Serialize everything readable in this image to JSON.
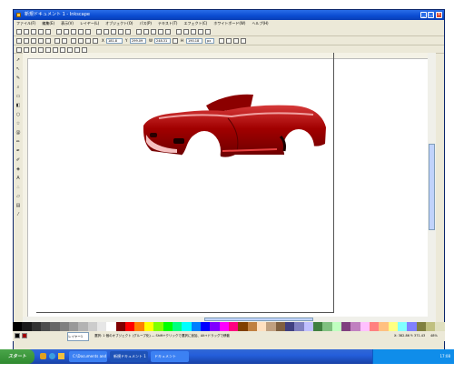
{
  "window": {
    "title": "新規ドキュメント 1 - Inkscape"
  },
  "menu": [
    "ファイル(F)",
    "編集(E)",
    "表示(V)",
    "レイヤー(L)",
    "オブジェクト(O)",
    "パス(P)",
    "テキスト(T)",
    "エフェクト(C)",
    "ホワイトボード(W)",
    "ヘルプ(H)"
  ],
  "toolbar2": {
    "x_label": "X",
    "x_value": "181.8",
    "y_label": "Y",
    "y_value": "299.09",
    "w_label": "W",
    "w_value": "248.31",
    "h_label": "H",
    "h_value": "190.18",
    "unit": "px"
  },
  "status": {
    "layer": "レイヤー1",
    "message": "選択: 1 個のオブジェクト (グループ化) — Shift+クリックで選択に追加、Alt+ドラッグで移動",
    "coords": "X: 382.86  Y: 371.43",
    "zoom": "48%"
  },
  "taskbar": {
    "start": "スタート",
    "tasks": [
      "C:\\Documents and Settings",
      "新規ドキュメント 1 - Inkscape",
      "ドキュメント"
    ],
    "clock": "17:08"
  },
  "colors": {
    "car_body": "#a10000",
    "car_highlight": "#e84040",
    "title_bar": "#0a4bd1"
  },
  "palette": [
    "#000000",
    "#1a1a1a",
    "#333333",
    "#4d4d4d",
    "#666666",
    "#808080",
    "#999999",
    "#b3b3b3",
    "#cccccc",
    "#e6e6e6",
    "#ffffff",
    "#800000",
    "#ff0000",
    "#ff8000",
    "#ffff00",
    "#80ff00",
    "#00ff00",
    "#00ff80",
    "#00ffff",
    "#0080ff",
    "#0000ff",
    "#8000ff",
    "#ff00ff",
    "#ff0080",
    "#804000",
    "#c08040",
    "#ffe0c0",
    "#c0a080",
    "#806040",
    "#404080",
    "#8080c0",
    "#c0c0ff",
    "#408040",
    "#80c080",
    "#c0ffc0",
    "#804080",
    "#c080c0",
    "#ffc0ff",
    "#ff8080",
    "#ffc080",
    "#ffff80",
    "#80ffff",
    "#8080ff",
    "#808040",
    "#c0c080",
    "#e0e0c0"
  ]
}
